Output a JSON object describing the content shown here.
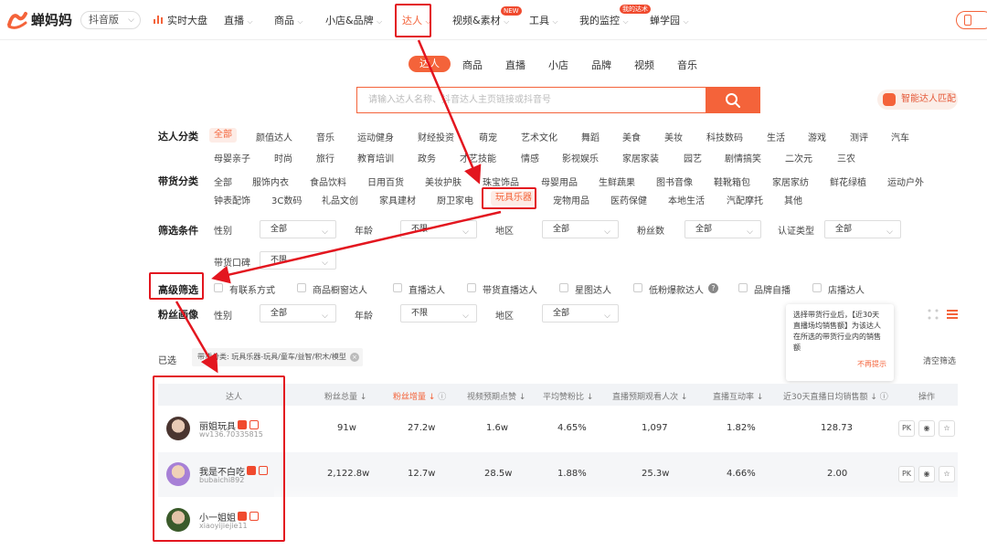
{
  "header": {
    "brand": "蝉妈妈",
    "edition": "抖音版",
    "nav": [
      "实时大盘",
      "直播",
      "商品",
      "小店&品牌",
      "达人",
      "视频&素材",
      "工具",
      "我的监控",
      "蝉学园"
    ],
    "badge_new": "NEW",
    "badge_monitor": "我的达术"
  },
  "tabs": [
    "达人",
    "商品",
    "直播",
    "小店",
    "品牌",
    "视频",
    "音乐"
  ],
  "search": {
    "placeholder": "请输入达人名称、抖音达人主页链接或抖音号"
  },
  "ai_button": "智能达人匹配",
  "talent_category": {
    "label": "达人分类",
    "row1": [
      "全部",
      "颜值达人",
      "音乐",
      "运动健身",
      "财经投资",
      "萌宠",
      "艺术文化",
      "舞蹈",
      "美食",
      "美妆",
      "科技数码",
      "生活",
      "游戏",
      "测评",
      "汽车"
    ],
    "row2": [
      "母婴亲子",
      "时尚",
      "旅行",
      "教育培训",
      "政务",
      "才艺技能",
      "情感",
      "影视娱乐",
      "家居家装",
      "园艺",
      "剧情搞笑",
      "二次元",
      "三农"
    ]
  },
  "goods_category": {
    "label": "带货分类",
    "row1": [
      "全部",
      "服饰内衣",
      "食品饮料",
      "日用百货",
      "美妆护肤",
      "珠宝饰品",
      "母婴用品",
      "生鲜蔬果",
      "图书音像",
      "鞋靴箱包",
      "家居家纺",
      "鲜花绿植",
      "运动户外"
    ],
    "row2": [
      "钟表配饰",
      "3C数码",
      "礼品文创",
      "家具建材",
      "厨卫家电",
      "玩具乐器",
      "宠物用品",
      "医药保健",
      "本地生活",
      "汽配摩托",
      "其他"
    ]
  },
  "filters": {
    "label": "筛选条件",
    "fields": [
      "性别",
      "年龄",
      "地区",
      "粉丝数",
      "认证类型"
    ],
    "values": [
      "全部",
      "不限",
      "全部",
      "全部",
      "全部"
    ],
    "reputation_label": "带货口碑",
    "reputation_value": "不限"
  },
  "advanced": {
    "label": "高级筛选",
    "options": [
      "有联系方式",
      "商品橱窗达人",
      "直播达人",
      "带货直播达人",
      "星图达人",
      "低粉爆款达人",
      "品牌自播",
      "店播达人"
    ]
  },
  "fans_profile": {
    "label": "粉丝画像",
    "fields": [
      "性别",
      "年龄",
      "地区"
    ],
    "values": [
      "全部",
      "不限",
      "全部"
    ]
  },
  "selected": {
    "label": "已选",
    "tag": "带货分类: 玩具乐器-玩具/童车/益智/积木/模型",
    "clear": "清空筛选"
  },
  "tooltip": {
    "text": "选择带货行业后，【近30天直播场均销售额】为该达人在所选的带货行业内的销售额",
    "dismiss": "不再提示"
  },
  "table": {
    "headers": [
      "达人",
      "粉丝总量",
      "粉丝增量",
      "视频预期点赞",
      "平均赞粉比",
      "直播预期观看人次",
      "直播互动率",
      "近30天直播日均销售额",
      "操作"
    ],
    "rows": [
      {
        "name": "丽姐玩具",
        "id": "wv136.70335815",
        "cells": [
          "91w",
          "27.2w",
          "1.6w",
          "4.65%",
          "1,097",
          "1.82%",
          "128.73"
        ]
      },
      {
        "name": "我是不白吃",
        "id": "bubaichi892",
        "cells": [
          "2,122.8w",
          "12.7w",
          "28.5w",
          "1.88%",
          "25.3w",
          "4.66%",
          "2.00"
        ]
      },
      {
        "name": "小一姐姐",
        "id": "xiaoyijiejie11",
        "cells": []
      }
    ],
    "op_pk": "PK"
  },
  "colors": {
    "accent": "#f4633a",
    "annotation": "#e3161f"
  }
}
